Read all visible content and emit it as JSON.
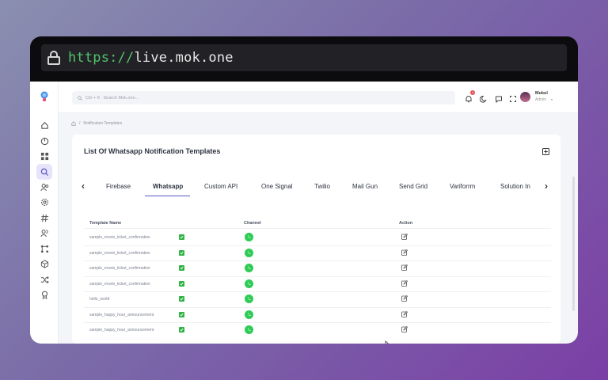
{
  "browser": {
    "url_protocol": "https://",
    "url_host": "live.mok.one"
  },
  "topbar": {
    "search_shortcut": "Ctrl + K",
    "search_placeholder": "Search Mok.one...",
    "notification_count": "4",
    "user_name": "Mukul",
    "user_role": "Admin"
  },
  "breadcrumb": {
    "current": "Notification Templates",
    "separator": "/"
  },
  "card": {
    "title": "List Of Whatsapp Notification Templates"
  },
  "tabs": [
    "Firebase",
    "Whatsapp",
    "Custom API",
    "One Signal",
    "Twilio",
    "Mail Gun",
    "Send Grid",
    "Variforrm",
    "Solution In"
  ],
  "active_tab": "Whatsapp",
  "table": {
    "headers": {
      "name": "Template Name",
      "channel": "Channel",
      "action": "Action"
    },
    "rows": [
      {
        "name": "sample_movie_ticket_confirmation"
      },
      {
        "name": "sample_movie_ticket_confirmation"
      },
      {
        "name": "sample_movie_ticket_confirmation"
      },
      {
        "name": "sample_movie_ticket_confirmation"
      },
      {
        "name": "hello_world"
      },
      {
        "name": "sample_happy_hour_announcement"
      },
      {
        "name": "sample_happy_hour_announcement"
      }
    ]
  },
  "icons": {
    "sidebar": [
      "home-icon",
      "dashboard-icon",
      "apps-icon",
      "search-icon",
      "users-icon",
      "settings-icon",
      "hash-icon",
      "team-icon",
      "flow-icon",
      "cube-icon",
      "shuffle-icon",
      "award-icon"
    ],
    "topbar": [
      "bell-icon",
      "moon-icon",
      "message-icon",
      "fullscreen-icon"
    ]
  },
  "colors": {
    "accent": "#5a55c9",
    "whatsapp": "#2ecc55",
    "check": "#2fb344"
  }
}
